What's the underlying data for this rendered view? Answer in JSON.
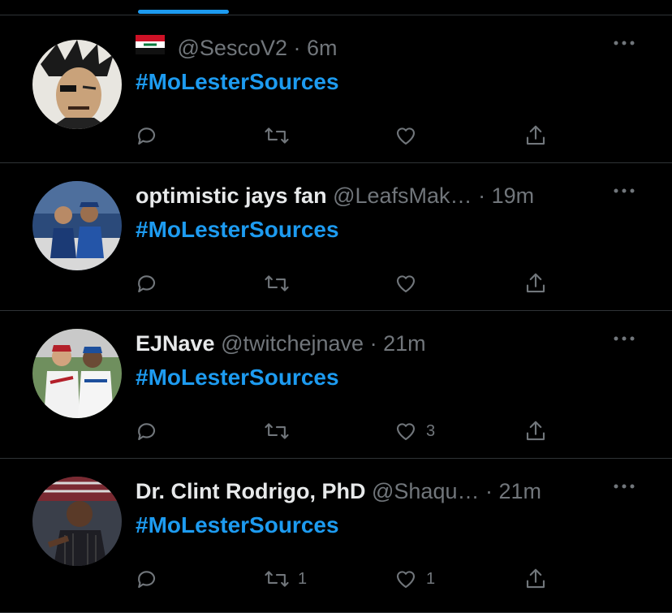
{
  "tweets": [
    {
      "flag": "iraq-flag",
      "name": "",
      "handle": "@SescoV2",
      "time": "6m",
      "text": "#MoLesterSources",
      "retweets": "",
      "likes": ""
    },
    {
      "name": "optimistic jays fan",
      "handle": "@LeafsMak…",
      "time": "19m",
      "text": "#MoLesterSources",
      "retweets": "",
      "likes": ""
    },
    {
      "name": "EJNave",
      "handle": "@twitchejnave",
      "time": "21m",
      "text": "#MoLesterSources",
      "retweets": "",
      "likes": "3"
    },
    {
      "name": "Dr. Clint Rodrigo, PhD",
      "handle": "@Shaqu…",
      "time": "21m",
      "text": "#MoLesterSources",
      "retweets": "1",
      "likes": "1"
    }
  ],
  "separator": "·",
  "colors": {
    "accent": "#1d9bf0",
    "muted": "#71767b",
    "divider": "#2f3336",
    "background": "#000000"
  }
}
